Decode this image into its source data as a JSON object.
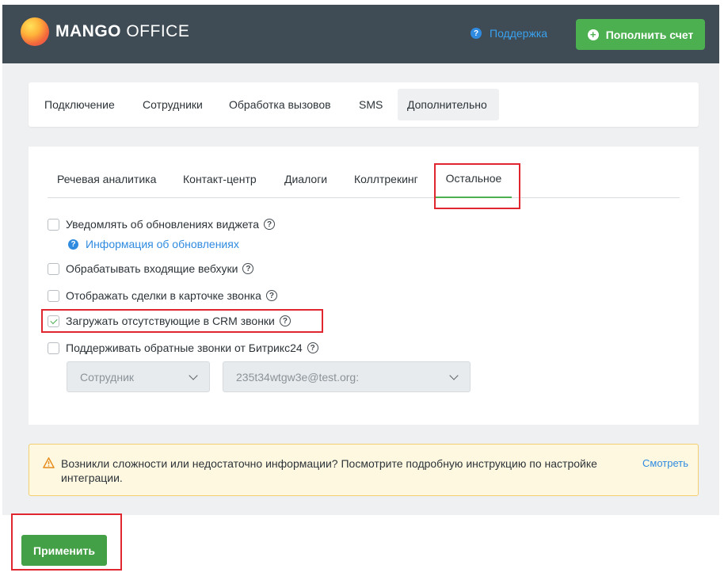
{
  "header": {
    "logo_bold": "MANGO",
    "logo_light": " OFFICE",
    "support_label": "Поддержка",
    "topup_label": "Пополнить счет",
    "colors": {
      "bar": "#3f4c55",
      "accent_green": "#4caf50",
      "link_blue": "#2f8be0"
    }
  },
  "main_tabs": [
    {
      "label": "Подключение"
    },
    {
      "label": "Сотрудники"
    },
    {
      "label": "Обработка вызовов"
    },
    {
      "label": "SMS"
    },
    {
      "label": "Дополнительно",
      "active": true
    }
  ],
  "sub_tabs": [
    {
      "label": "Речевая аналитика"
    },
    {
      "label": "Контакт-центр"
    },
    {
      "label": "Диалоги"
    },
    {
      "label": "Коллтрекинг"
    },
    {
      "label": "Остальное",
      "active": true
    }
  ],
  "options": [
    {
      "label": "Уведомлять об обновлениях виджета",
      "checked": false
    },
    {
      "label": "Обрабатывать входящие вебхуки",
      "checked": false
    },
    {
      "label": "Отображать сделки в карточке звонка",
      "checked": false
    },
    {
      "label": "Загружать отсутствующие в CRM звонки",
      "checked": true
    },
    {
      "label": "Поддерживать обратные звонки от Битрикс24",
      "checked": false
    }
  ],
  "info_link": "Информация об обновлениях",
  "selects": {
    "employee": "Сотрудник",
    "email": "235t34wtgw3e@test.org:"
  },
  "notice": {
    "text": "Возникли сложности или недостаточно информации? Посмотрите подробную инструкцию по настройке интеграции.",
    "link": "Смотреть"
  },
  "apply_label": "Применить",
  "icons": {
    "help": "?",
    "plus": "+"
  }
}
